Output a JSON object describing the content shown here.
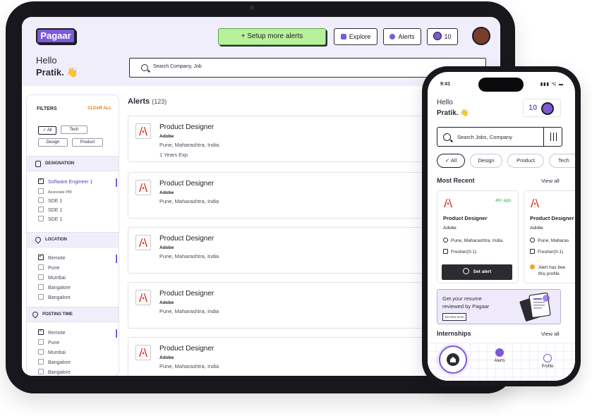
{
  "tablet": {
    "logo": "Pagaar",
    "greeting": "Hello",
    "user_name": "Pratik.",
    "wave_emoji": "👋",
    "header_buttons": {
      "setup_alerts": "+ Setup more alerts",
      "explore": "Explore",
      "alerts": "Alerts",
      "coins": "10"
    },
    "search_placeholder": "Search Company, Job",
    "filters": {
      "title": "FILTERS",
      "clear_all": "CLEAR ALL",
      "chips": [
        "All",
        "Tech",
        "Design",
        "Product"
      ],
      "active_chip": "All",
      "sections": [
        {
          "title": "DESIGNATION",
          "icon": "stack-icon",
          "options": [
            {
              "label": "Software Engineer 1",
              "checked": true
            },
            {
              "label": "Associate PM",
              "checked": false
            },
            {
              "label": "SDE 1",
              "checked": false
            },
            {
              "label": "SDE 1",
              "checked": false
            },
            {
              "label": "SDE 1",
              "checked": false
            }
          ]
        },
        {
          "title": "LOCATION",
          "icon": "location-pin-icon",
          "options": [
            {
              "label": "Remote",
              "checked": true
            },
            {
              "label": "Pune",
              "checked": false
            },
            {
              "label": "Mumbai",
              "checked": false
            },
            {
              "label": "Bangalore",
              "checked": false
            },
            {
              "label": "Bangalore",
              "checked": false
            }
          ]
        },
        {
          "title": "POSTING TIME",
          "icon": "location-pin-icon",
          "options": [
            {
              "label": "Remote",
              "checked": true
            },
            {
              "label": "Pune",
              "checked": false
            },
            {
              "label": "Mumbai",
              "checked": false
            },
            {
              "label": "Bangalore",
              "checked": false
            },
            {
              "label": "Bangalore",
              "checked": false
            }
          ]
        }
      ]
    },
    "alerts": {
      "title": "Alerts",
      "count": "(123)",
      "items": [
        {
          "title": "Product Designer",
          "company": "Adobe",
          "location": "Pune, Maharashtra, India.",
          "experience": "1 Years Exp"
        },
        {
          "title": "Product Designer",
          "company": "Adobe",
          "location": "Pune, Maharashtra, India"
        },
        {
          "title": "Product Designer",
          "company": "Adobe",
          "location": "Pune, Maharashtra, India"
        },
        {
          "title": "Product Designer",
          "company": "Adobe",
          "location": "Pune, Maharashtra, India"
        },
        {
          "title": "Product Designer",
          "company": "Adobe",
          "location": "Pune, Maharashtra, India"
        }
      ]
    }
  },
  "phone": {
    "time": "9:41",
    "status_icons": "▮▮▮ ⌥ ▬",
    "greeting": "Hello",
    "user_name": "Pratik.",
    "wave_emoji": "👋",
    "coins": "10",
    "search_placeholder": "Search Jobs, Company",
    "chips": [
      "All",
      "Design",
      "Product",
      "Tech"
    ],
    "active_chip": "All",
    "most_recent": {
      "title": "Most Recent",
      "view_all": "View all",
      "cards": [
        {
          "title": "Product Designer",
          "company": "Adobe",
          "posted": "4hr ago.",
          "location": "Pune, Maharashtra, India.",
          "experience": "Fresher(0-1)",
          "action": "Set alert"
        },
        {
          "title": "Product Designer",
          "company": "Adobe",
          "location": "Pune, Maharas",
          "experience": "Fresher(0-1)",
          "note_line1": "Alert has bee",
          "note_line2": "this profile."
        }
      ]
    },
    "banner": {
      "line1": "Get your resume",
      "line2": "reviewed by Pagaar",
      "button": "REVIEW NOW"
    },
    "internships": {
      "title": "Internships",
      "view_all": "View all"
    },
    "nav": {
      "alerts": "Alerts",
      "profile": "Profile"
    }
  },
  "colors": {
    "brand_purple": "#7c5ad6",
    "header_lavender": "#f1eefb",
    "setup_green": "#b9f19a",
    "clear_all_orange": "#e8781b",
    "recent_green": "#2fb344",
    "adobe_red": "#e1251b"
  }
}
